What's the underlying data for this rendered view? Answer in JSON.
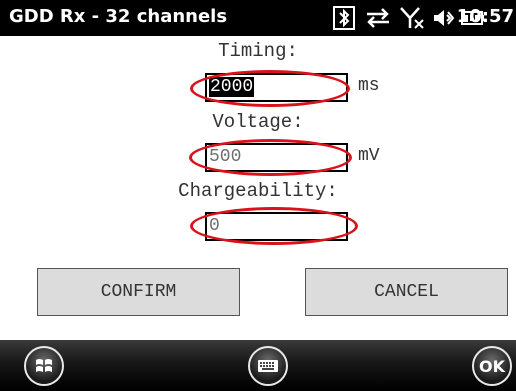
{
  "titlebar": {
    "app_title": "GDD Rx - 32 channels",
    "clock": "10:57",
    "status_icons": [
      "bluetooth-icon",
      "sync-icon",
      "no-signal-icon",
      "volume-icon",
      "battery-icon"
    ]
  },
  "form": {
    "timing": {
      "label": "Timing:",
      "value": "2000",
      "unit": "ms"
    },
    "voltage": {
      "label": "Voltage:",
      "value": "500",
      "unit": "mV"
    },
    "chargeability": {
      "label": "Chargeability:",
      "value": "0"
    }
  },
  "buttons": {
    "confirm": "CONFIRM",
    "cancel": "CANCEL"
  },
  "bottombar": {
    "start_icon": "windows-start-icon",
    "keyboard_icon": "keyboard-icon",
    "ok": "OK"
  },
  "colors": {
    "highlight_ring": "#d9121b",
    "button_bg": "#dcdcdc",
    "bar_bg": "#000000"
  }
}
